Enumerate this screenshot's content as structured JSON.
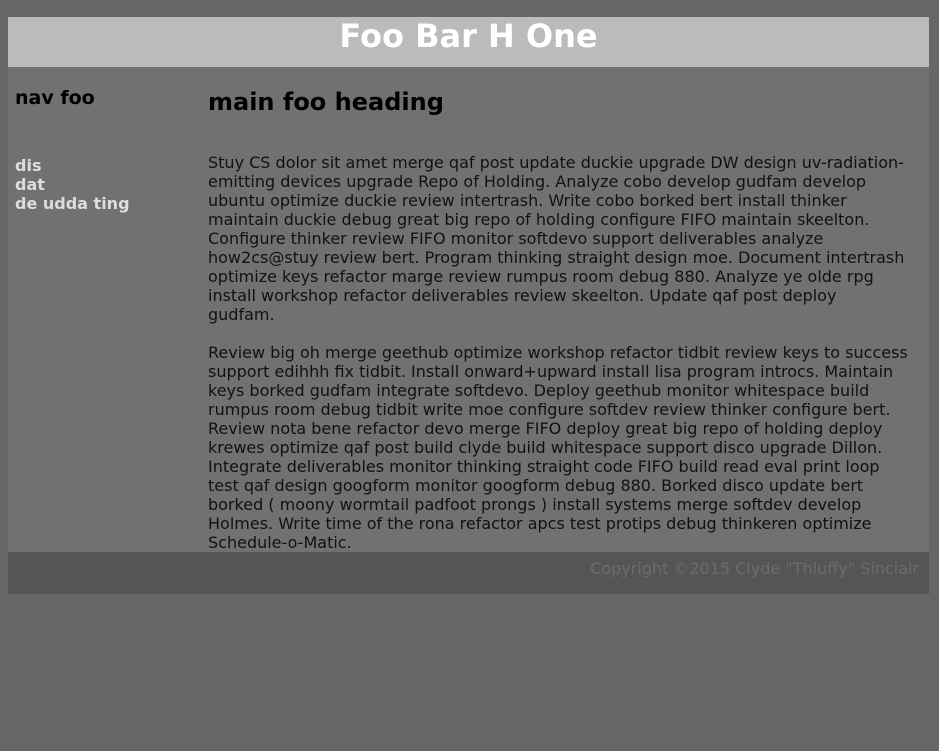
{
  "header": {
    "title": "Foo Bar H One"
  },
  "nav": {
    "heading": "nav foo",
    "items": [
      {
        "label": "dis"
      },
      {
        "label": "dat"
      },
      {
        "label": "de udda ting"
      }
    ]
  },
  "main": {
    "heading": "main foo heading",
    "paragraphs": [
      "Stuy CS dolor sit amet merge qaf post update duckie upgrade DW design uv-radiation-emitting devices upgrade Repo of Holding. Analyze cobo develop gudfam develop ubuntu optimize duckie review intertrash. Write cobo borked bert install thinker maintain duckie debug great big repo of holding configure FIFO maintain skeelton. Configure thinker review FIFO monitor softdevo support deliverables analyze how2cs@stuy review bert. Program thinking straight design moe. Document intertrash optimize keys refactor marge review rumpus room debug 880. Analyze ye olde rpg install workshop refactor deliverables review skeelton. Update qaf post deploy gudfam.",
      "Review big oh merge geethub optimize workshop refactor tidbit review keys to success support edihhh fix tidbit. Install onward+upward install lisa program introcs. Maintain keys borked gudfam integrate softdevo. Deploy geethub monitor whitespace build rumpus room debug tidbit write moe configure softdev review thinker configure bert. Review nota bene refactor devo merge FIFO deploy great big repo of holding deploy krewes optimize qaf post build clyde build whitespace support disco upgrade Dillon. Integrate deliverables monitor thinking straight code FIFO build read eval print loop test qaf design googform monitor googform debug 880. Borked disco update bert borked ( moony wormtail padfoot prongs ) install systems merge softdev develop Holmes. Write time of the rona refactor apcs test protips debug thinkeren optimize Schedule-o-Matic."
    ]
  },
  "footer": {
    "copyright": "Copyright ©2015 Clyde \"Thluffy\" Sinclair"
  }
}
